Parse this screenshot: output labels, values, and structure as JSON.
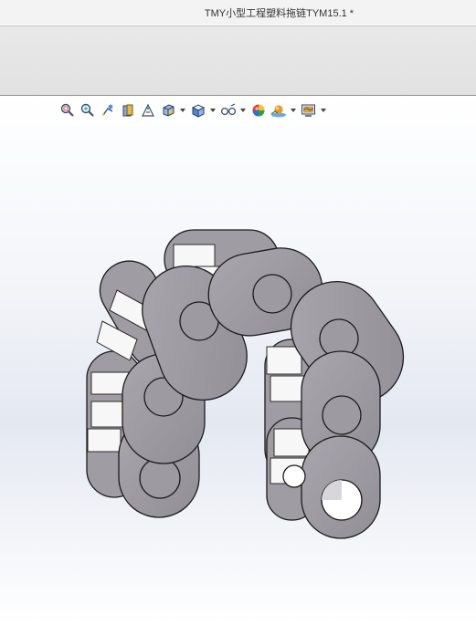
{
  "window": {
    "title": "TMY小型工程塑料拖链TYM15.1 *"
  },
  "heads_up_toolbar": {
    "icons": [
      "zoom-to-fit-icon",
      "zoom-to-area-icon",
      "previous-view-icon",
      "section-view-icon",
      "dynamic-annotation-icon",
      "view-orientation-icon",
      "display-style-icon",
      "hide-show-items-icon",
      "edit-appearance-icon",
      "apply-scene-icon",
      "view-settings-icon"
    ]
  },
  "colors": {
    "link_face": "#9c98a0",
    "link_highlight": "#aaa6ae",
    "link_edge": "#1b1b1b",
    "crossbar": "#f7f7f7",
    "ribbon": "#e6e6e6",
    "titlebar": "#f3f3f3"
  }
}
